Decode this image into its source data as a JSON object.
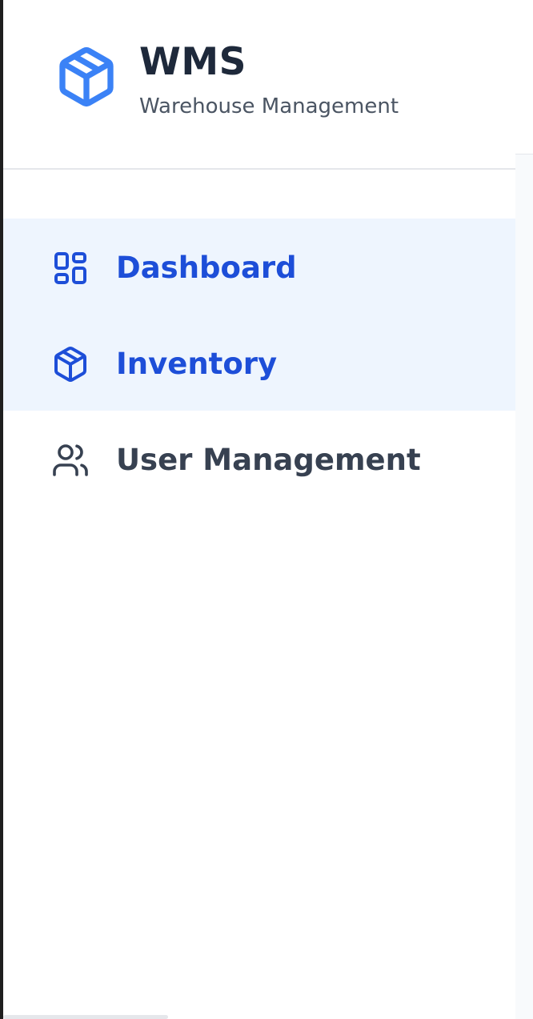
{
  "brand": {
    "title": "WMS",
    "subtitle": "Warehouse Management",
    "logo_icon": "package-icon",
    "logo_color": "#3b82f6"
  },
  "nav": {
    "items": [
      {
        "label": "Dashboard",
        "icon": "dashboard-grid-icon",
        "state": "active"
      },
      {
        "label": "Inventory",
        "icon": "package-icon",
        "state": "selected"
      },
      {
        "label": "User Management",
        "icon": "users-icon",
        "state": "default"
      }
    ]
  },
  "colors": {
    "accent": "#3b82f6",
    "active_text": "#1d4ed8",
    "active_background": "#eef5fe",
    "default_text": "#374151",
    "title_text": "#1e293b"
  }
}
